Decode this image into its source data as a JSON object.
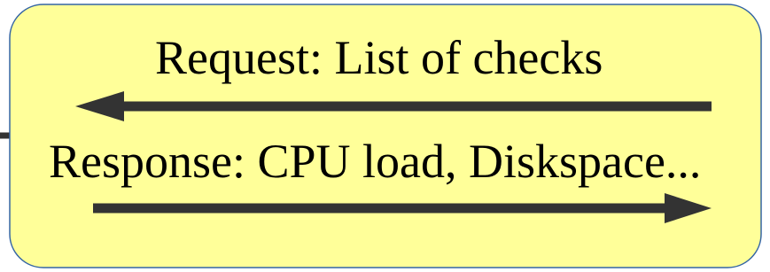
{
  "diagram": {
    "request_label": "Request: List of checks",
    "response_label": "Response: CPU load, Diskspace...",
    "colors": {
      "box_fill": "#ffff99",
      "box_border": "#3465a4",
      "arrow": "#333333",
      "text": "#000000"
    },
    "arrows": {
      "request": "right-to-left",
      "response": "left-to-right"
    }
  }
}
